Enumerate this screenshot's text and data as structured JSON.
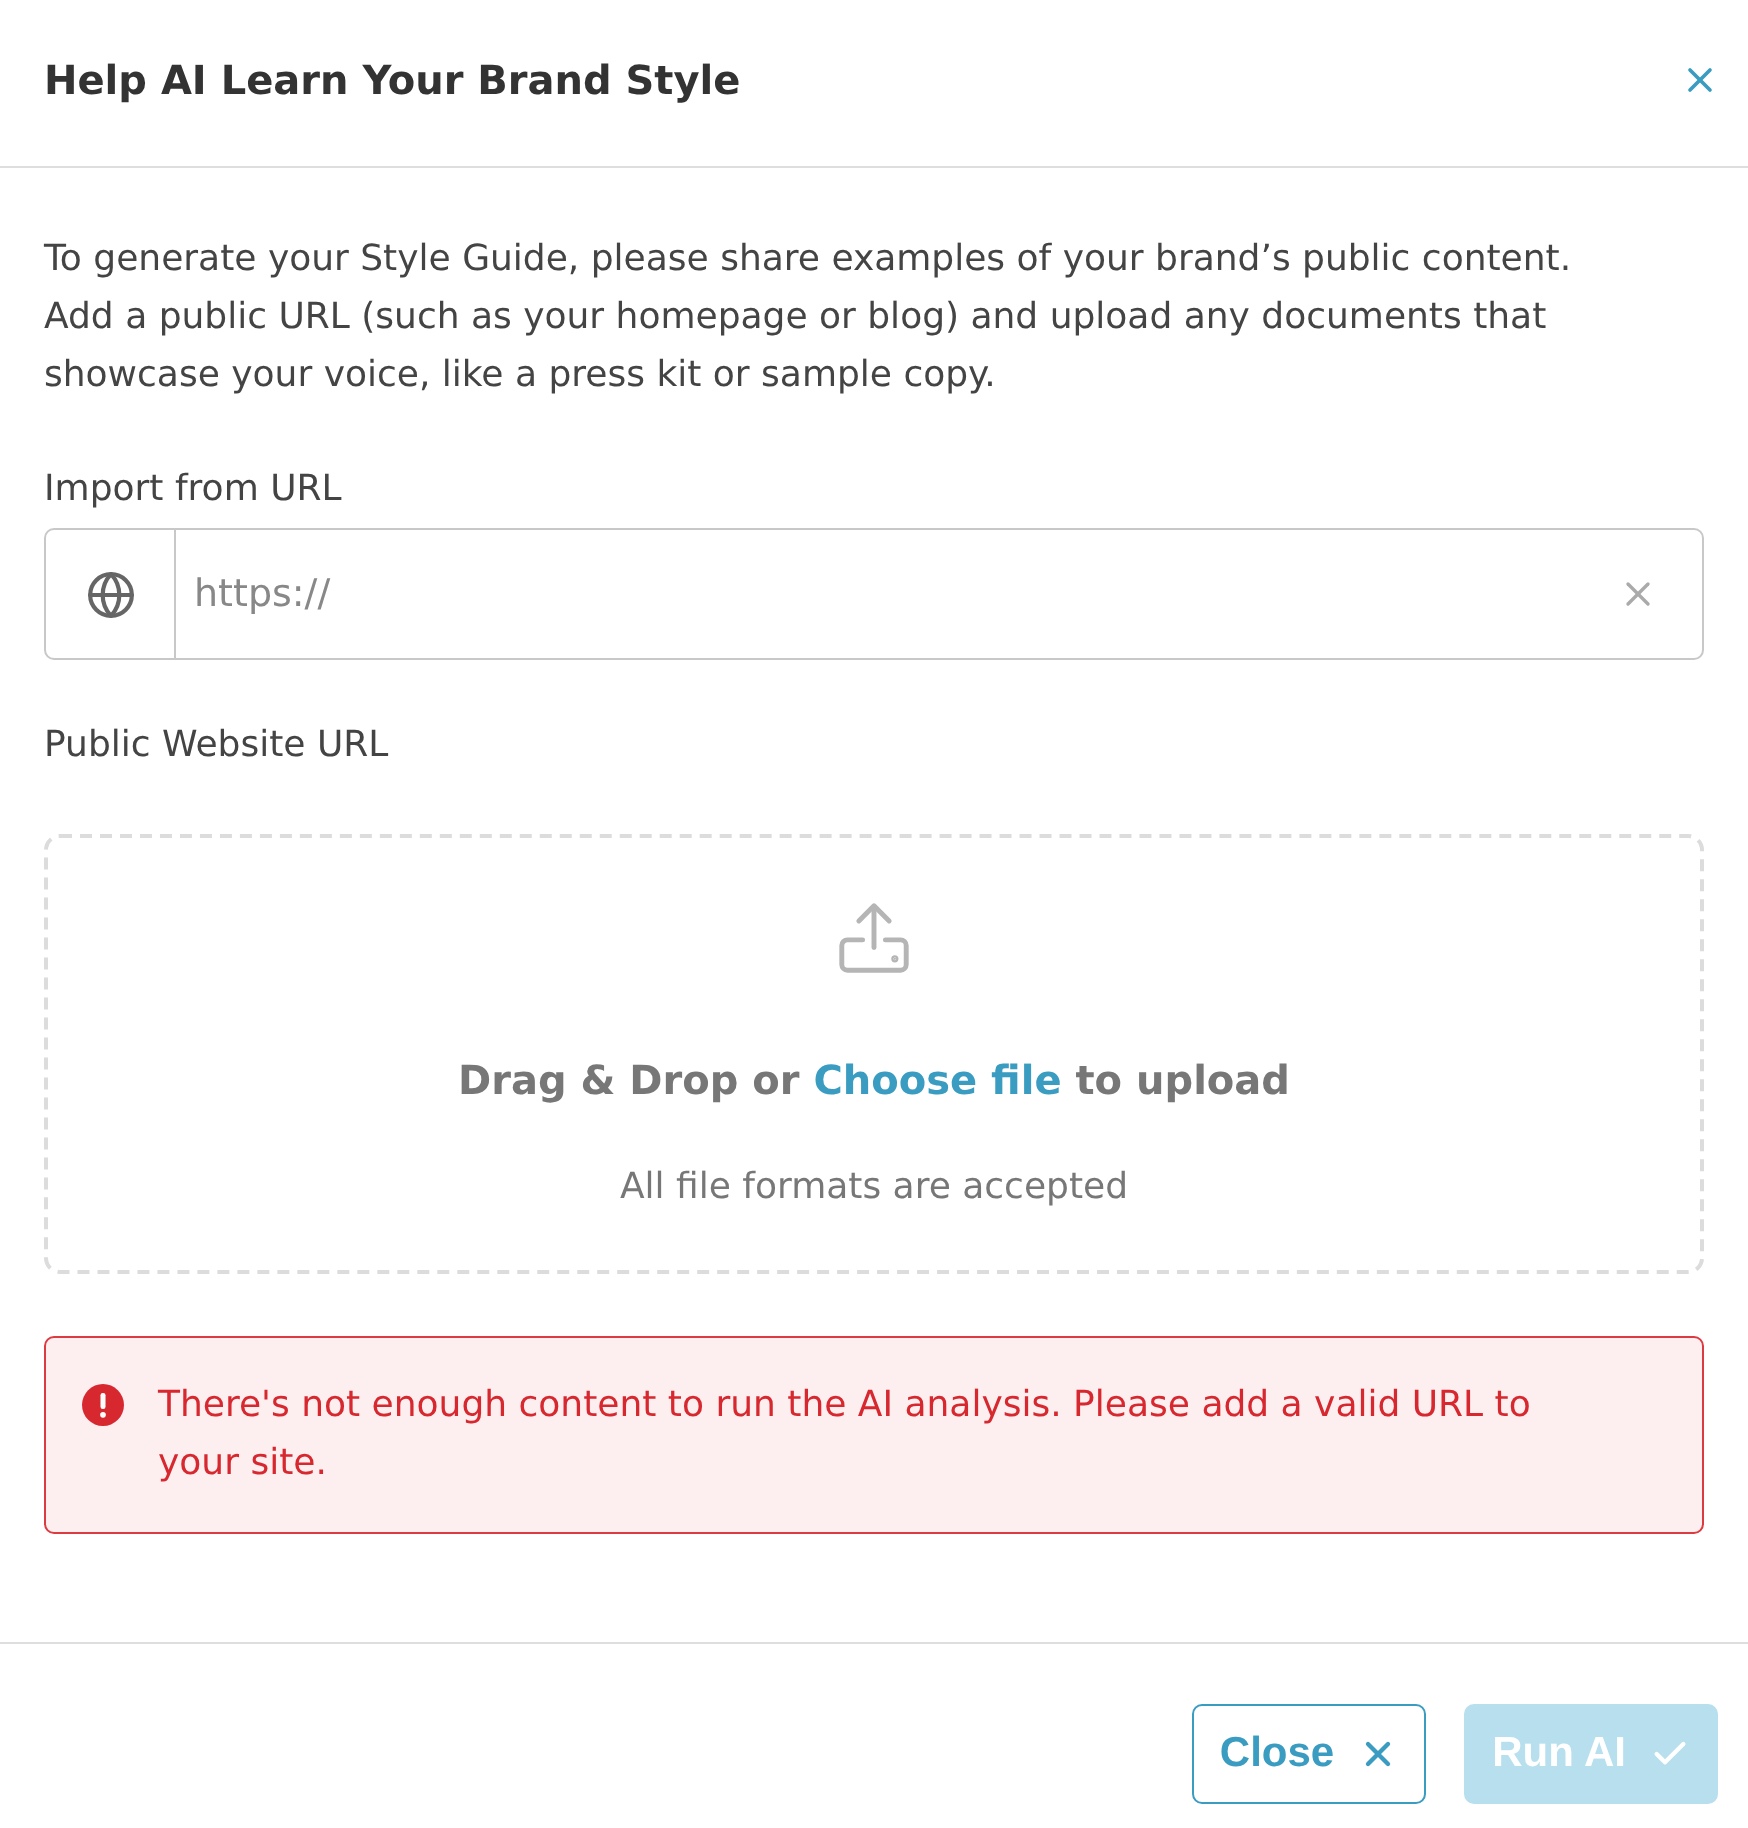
{
  "dialog": {
    "title": "Help AI Learn Your Brand Style"
  },
  "description": "To generate your Style Guide, please share examples of your brand’s public content. Add a public URL (such as your homepage or blog) and upload any documents that showcase your voice, like a press kit or sample copy.",
  "url_field": {
    "label": "Import from URL",
    "placeholder": "https://"
  },
  "upload": {
    "label": "Public Website URL",
    "prompt_before": "Drag & Drop or",
    "link": "Choose file",
    "prompt_after": "to upload",
    "hint": "All file formats are accepted"
  },
  "error": {
    "message": "There's not enough content to run the AI analysis. Please add a valid URL to your site."
  },
  "buttons": [
    {
      "label": "Close",
      "kind": "secondary",
      "disabled": false
    },
    {
      "label": "Run AI",
      "kind": "primary",
      "disabled": true
    }
  ]
}
